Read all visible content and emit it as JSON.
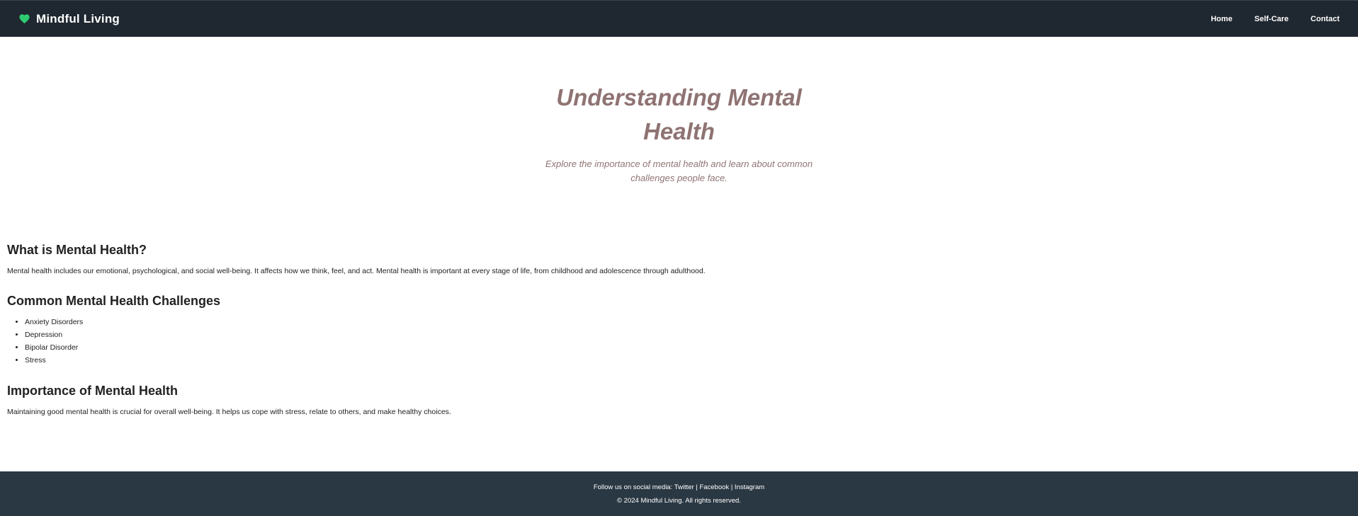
{
  "header": {
    "brand_name": "Mindful Living",
    "brand_icon": "heart-icon",
    "brand_icon_color": "#2ecc71",
    "nav": [
      {
        "label": "Home"
      },
      {
        "label": "Self-Care"
      },
      {
        "label": "Contact"
      }
    ]
  },
  "hero": {
    "title": "Understanding Mental Health",
    "subtitle": "Explore the importance of mental health and learn about common challenges people face."
  },
  "sections": {
    "what_is": {
      "heading": "What is Mental Health?",
      "text": "Mental health includes our emotional, psychological, and social well-being. It affects how we think, feel, and act. Mental health is important at every stage of life, from childhood and adolescence through adulthood."
    },
    "challenges": {
      "heading": "Common Mental Health Challenges",
      "items": [
        "Anxiety Disorders",
        "Depression",
        "Bipolar Disorder",
        "Stress"
      ]
    },
    "importance": {
      "heading": "Importance of Mental Health",
      "text": "Maintaining good mental health is crucial for overall well-being. It helps us cope with stress, relate to others, and make healthy choices."
    }
  },
  "footer": {
    "follow_prefix": "Follow us on social media:",
    "social_links": [
      "Twitter",
      "Facebook",
      "Instagram"
    ],
    "separator": "|",
    "copyright": "© 2024 Mindful Living. All rights reserved."
  },
  "colors": {
    "navbar_bg": "#1f2730",
    "footer_bg": "#2a3843",
    "hero_text": "#8f7373"
  }
}
